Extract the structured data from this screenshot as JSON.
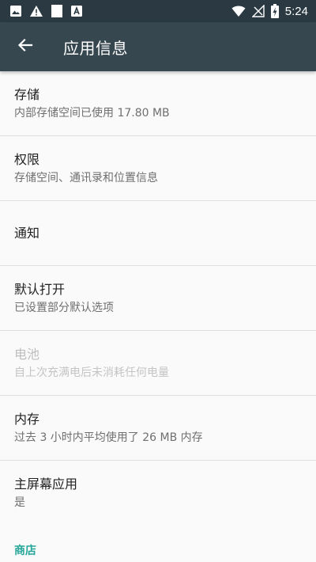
{
  "status_bar": {
    "time": "5:24",
    "left_icons": [
      "image-icon",
      "warning-icon",
      "blank-notification-icon",
      "store-icon"
    ],
    "right_icons": [
      "wifi-icon",
      "signal-off-icon",
      "battery-charging-icon"
    ]
  },
  "toolbar": {
    "title": "应用信息",
    "back_icon": "arrow-back-icon"
  },
  "items": [
    {
      "title": "存储",
      "summary": "内部存储空间已使用 17.80 MB",
      "enabled": true
    },
    {
      "title": "权限",
      "summary": "存储空间、通讯录和位置信息",
      "enabled": true
    },
    {
      "title": "通知",
      "summary": "",
      "enabled": true
    },
    {
      "title": "默认打开",
      "summary": "已设置部分默认选项",
      "enabled": true
    },
    {
      "title": "电池",
      "summary": "自上次充满电后未消耗任何电量",
      "enabled": false
    },
    {
      "title": "内存",
      "summary": "过去 3 小时内平均使用了 26 MB 内存",
      "enabled": true
    },
    {
      "title": "主屏幕应用",
      "summary": "是",
      "enabled": true
    }
  ],
  "category": {
    "label": "商店"
  },
  "colors": {
    "status_bar": "#2b3a42",
    "toolbar": "#37474f",
    "accent": "#26a69a",
    "background": "#fafafa"
  }
}
